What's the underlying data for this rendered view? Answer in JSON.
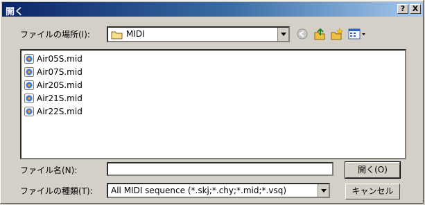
{
  "window": {
    "title": "開く",
    "help_button": "?",
    "close_button": "X"
  },
  "look_in": {
    "label": "ファイルの場所(I):",
    "value": "MIDI"
  },
  "toolbar": {
    "icons": [
      "back-icon",
      "up-folder-icon",
      "new-folder-icon",
      "view-menu-icon"
    ]
  },
  "files": [
    {
      "name": "Air05S.mid"
    },
    {
      "name": "Air07S.mid"
    },
    {
      "name": "Air20S.mid"
    },
    {
      "name": "Air21S.mid"
    },
    {
      "name": "Air22S.mid"
    }
  ],
  "filename": {
    "label": "ファイル名(N):",
    "value": ""
  },
  "filetype": {
    "label": "ファイルの種類(T):",
    "value": "All MIDI sequence (*.skj;*.chy;*.mid;*.vsq)"
  },
  "buttons": {
    "open": "開く(O)",
    "cancel": "キャンセル"
  }
}
